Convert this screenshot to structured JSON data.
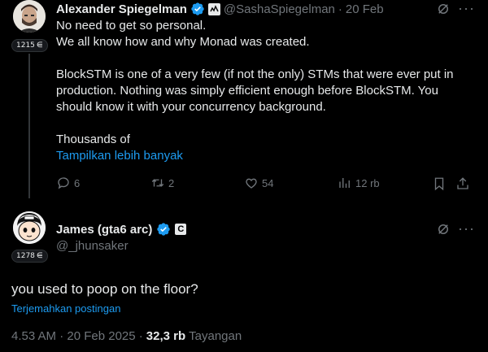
{
  "tweet1": {
    "author_name": "Alexander Spiegelman",
    "handle": "@SashaSpiegelman",
    "separator": "·",
    "date": "20 Feb",
    "badge_count": "1215",
    "lines": [
      "No need to get so personal.",
      "We all know how and why Monad was created.",
      "",
      "BlockSTM is one of a very few (if not the only) STMs that were ever put in",
      "production. Nothing was simply efficient enough before BlockSTM. You",
      "should know it with your concurrency background.",
      "",
      "Thousands of"
    ],
    "show_more": "Tampilkan lebih banyak",
    "actions": {
      "replies": "6",
      "reposts": "2",
      "likes": "54",
      "views": "12 rb"
    }
  },
  "tweet2": {
    "author_name": "James (gta6 arc)",
    "handle": "@_jhunsaker",
    "badge_count": "1278",
    "affiliate_letter": "C",
    "text": "you used to poop on the floor?",
    "translate": "Terjemahkan postingan",
    "time": "4.53 AM · 20 Feb 2025 ·",
    "views_count": "32,3 rb",
    "views_label": "Tayangan"
  },
  "colors": {
    "background": "#000000",
    "text": "#e7e9ea",
    "muted": "#71767b",
    "link": "#1d9bf0",
    "verified": "#1d9bf0"
  },
  "icons": [
    "verified-icon",
    "grok-icon",
    "more-icon",
    "reply-icon",
    "repost-icon",
    "like-icon",
    "views-icon",
    "bookmark-icon",
    "share-icon",
    "badge-icon"
  ]
}
